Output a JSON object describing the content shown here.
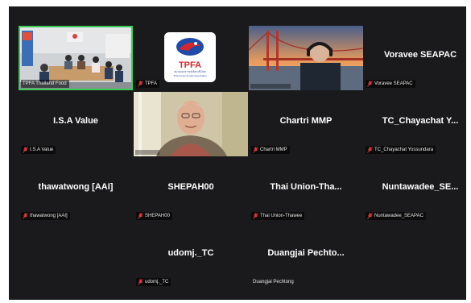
{
  "colors": {
    "background": "#1a1a1c",
    "active_speaker": "#3ccc5a",
    "muted_icon": "#e5383b",
    "name_text": "#ffffff"
  },
  "participants": [
    {
      "display": "",
      "label": "TPFA Thailand Food",
      "type": "video",
      "muted": false,
      "active": true
    },
    {
      "display": "",
      "label": "TPFA",
      "type": "logo",
      "muted": true,
      "logo_text": "TPFA",
      "logo_sub": "สมาคมอาหารแช่เยือกแข็งไทย",
      "logo_sub2": "Thai Frozen Foods Association"
    },
    {
      "display": "",
      "label": "",
      "type": "video",
      "muted": false
    },
    {
      "display": "Voravee SEAPAC",
      "label": "Voravee SEAPAC",
      "type": "name",
      "muted": true
    },
    {
      "display": "I.S.A Value",
      "label": "I.S.A Value",
      "type": "name",
      "muted": true
    },
    {
      "display": "",
      "label": "",
      "type": "video",
      "muted": false
    },
    {
      "display": "Chartri MMP",
      "label": "Chartri MMP",
      "type": "name",
      "muted": true
    },
    {
      "display": "TC_Chayachat Y...",
      "label": "TC_Chayachat Yossundara",
      "type": "name",
      "muted": true
    },
    {
      "display": "thawatwong [AAI]",
      "label": "thawatwong [AAI]",
      "type": "name",
      "muted": true
    },
    {
      "display": "SHEPAH00",
      "label": "SHEPAH00",
      "type": "name",
      "muted": true
    },
    {
      "display": "Thai Union-Tha...",
      "label": "Thai Union-Thawee",
      "type": "name",
      "muted": true
    },
    {
      "display": "Nuntawadee_SE...",
      "label": "Nuntawadee_SEAPAC",
      "type": "name",
      "muted": true
    },
    {
      "display": "udomj._TC",
      "label": "udomj._TC",
      "type": "name",
      "muted": true
    },
    {
      "display": "Duangjai Pechto...",
      "label": "Duangjai Pechtong",
      "type": "name",
      "muted": false
    }
  ]
}
